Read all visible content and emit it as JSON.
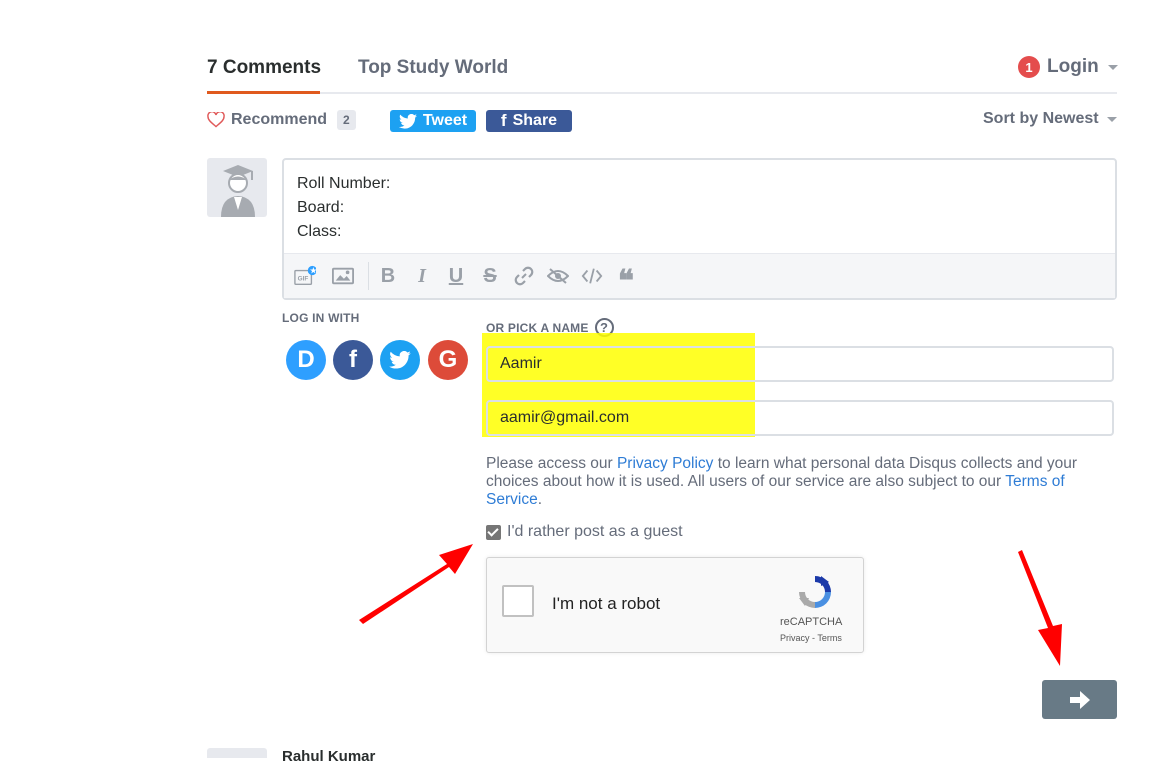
{
  "header": {
    "tabs": [
      {
        "label": "7 Comments",
        "active": true
      },
      {
        "label": "Top Study World",
        "active": false
      }
    ],
    "login_label": "Login",
    "notification_count": "1"
  },
  "actions": {
    "recommend_label": "Recommend",
    "recommend_count": "2",
    "tweet_label": "Tweet",
    "share_label": "Share",
    "sort_label": "Sort by Newest"
  },
  "editor": {
    "text": "Roll Number:\nBoard:\nClass:",
    "toolbar_icons": [
      "gif-icon",
      "image-icon",
      "bold-icon",
      "italic-icon",
      "underline-icon",
      "strikethrough-icon",
      "link-icon",
      "spoiler-icon",
      "code-icon",
      "quote-icon"
    ]
  },
  "auth": {
    "login_with_label": "LOG IN WITH",
    "pick_name_label": "OR PICK A NAME",
    "help_glyph": "?",
    "name_value": "Aamir",
    "email_value": "aamir@gmail.com",
    "policy_prefix": "Please access our ",
    "policy_link": "Privacy Policy",
    "policy_middle": " to learn what personal data Disqus collects and your choices about how it is used. All users of our service are also subject to our ",
    "terms_link": "Terms of Service",
    "policy_suffix": ".",
    "guest_label": "I'd rather post as a guest",
    "guest_checked": true
  },
  "recaptcha": {
    "label": "I'm not a robot",
    "brand": "reCAPTCHA",
    "terms": "Privacy - Terms"
  },
  "colors": {
    "accent": "#e05a1e",
    "highlight": "#ffff00",
    "arrow": "#ff0000",
    "submit": "#687a86"
  },
  "footer": {
    "next_author": "Rahul Kumar"
  }
}
